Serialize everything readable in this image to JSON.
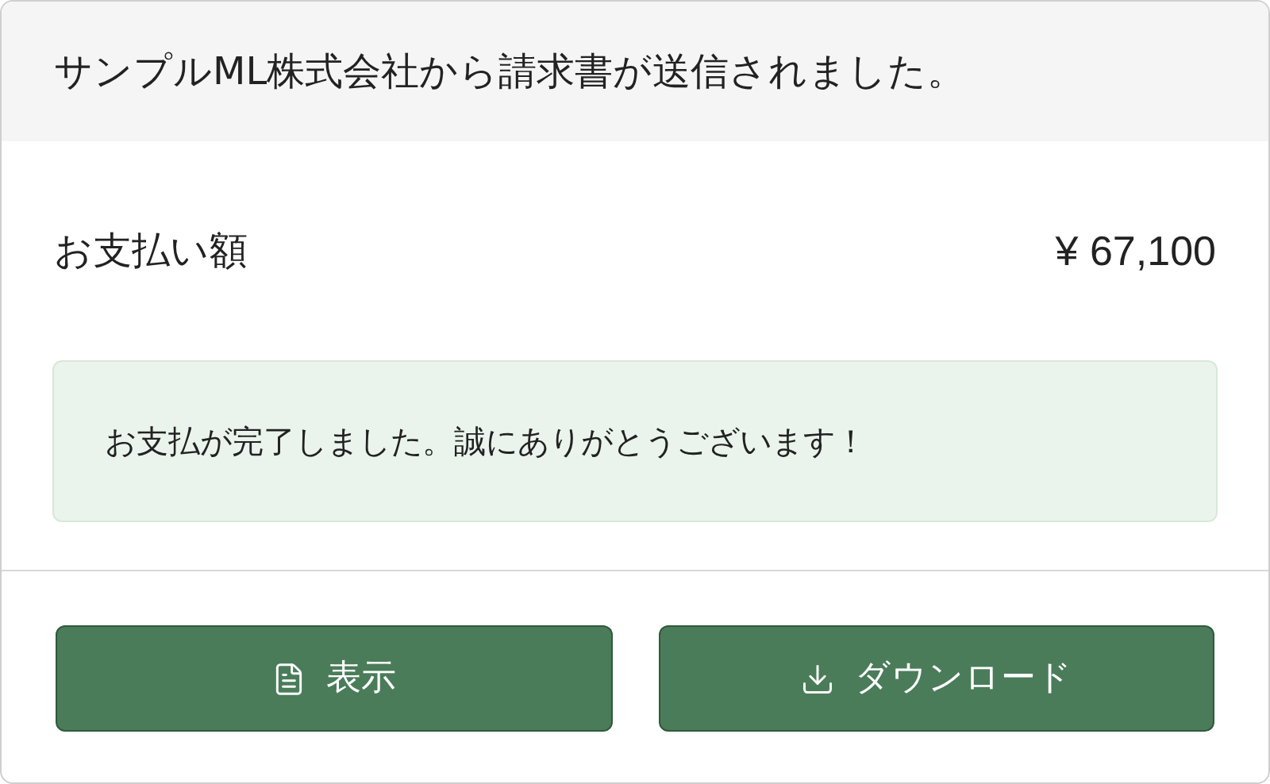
{
  "header": {
    "title": "サンプルML株式会社から請求書が送信されました。"
  },
  "amount": {
    "label": "お支払い額",
    "value": "¥ 67,100"
  },
  "alert": {
    "message": "お支払が完了しました。誠にありがとうございます！"
  },
  "buttons": [
    {
      "kind": "view",
      "label": "表示"
    },
    {
      "kind": "download",
      "label": "ダウンロード"
    }
  ]
}
